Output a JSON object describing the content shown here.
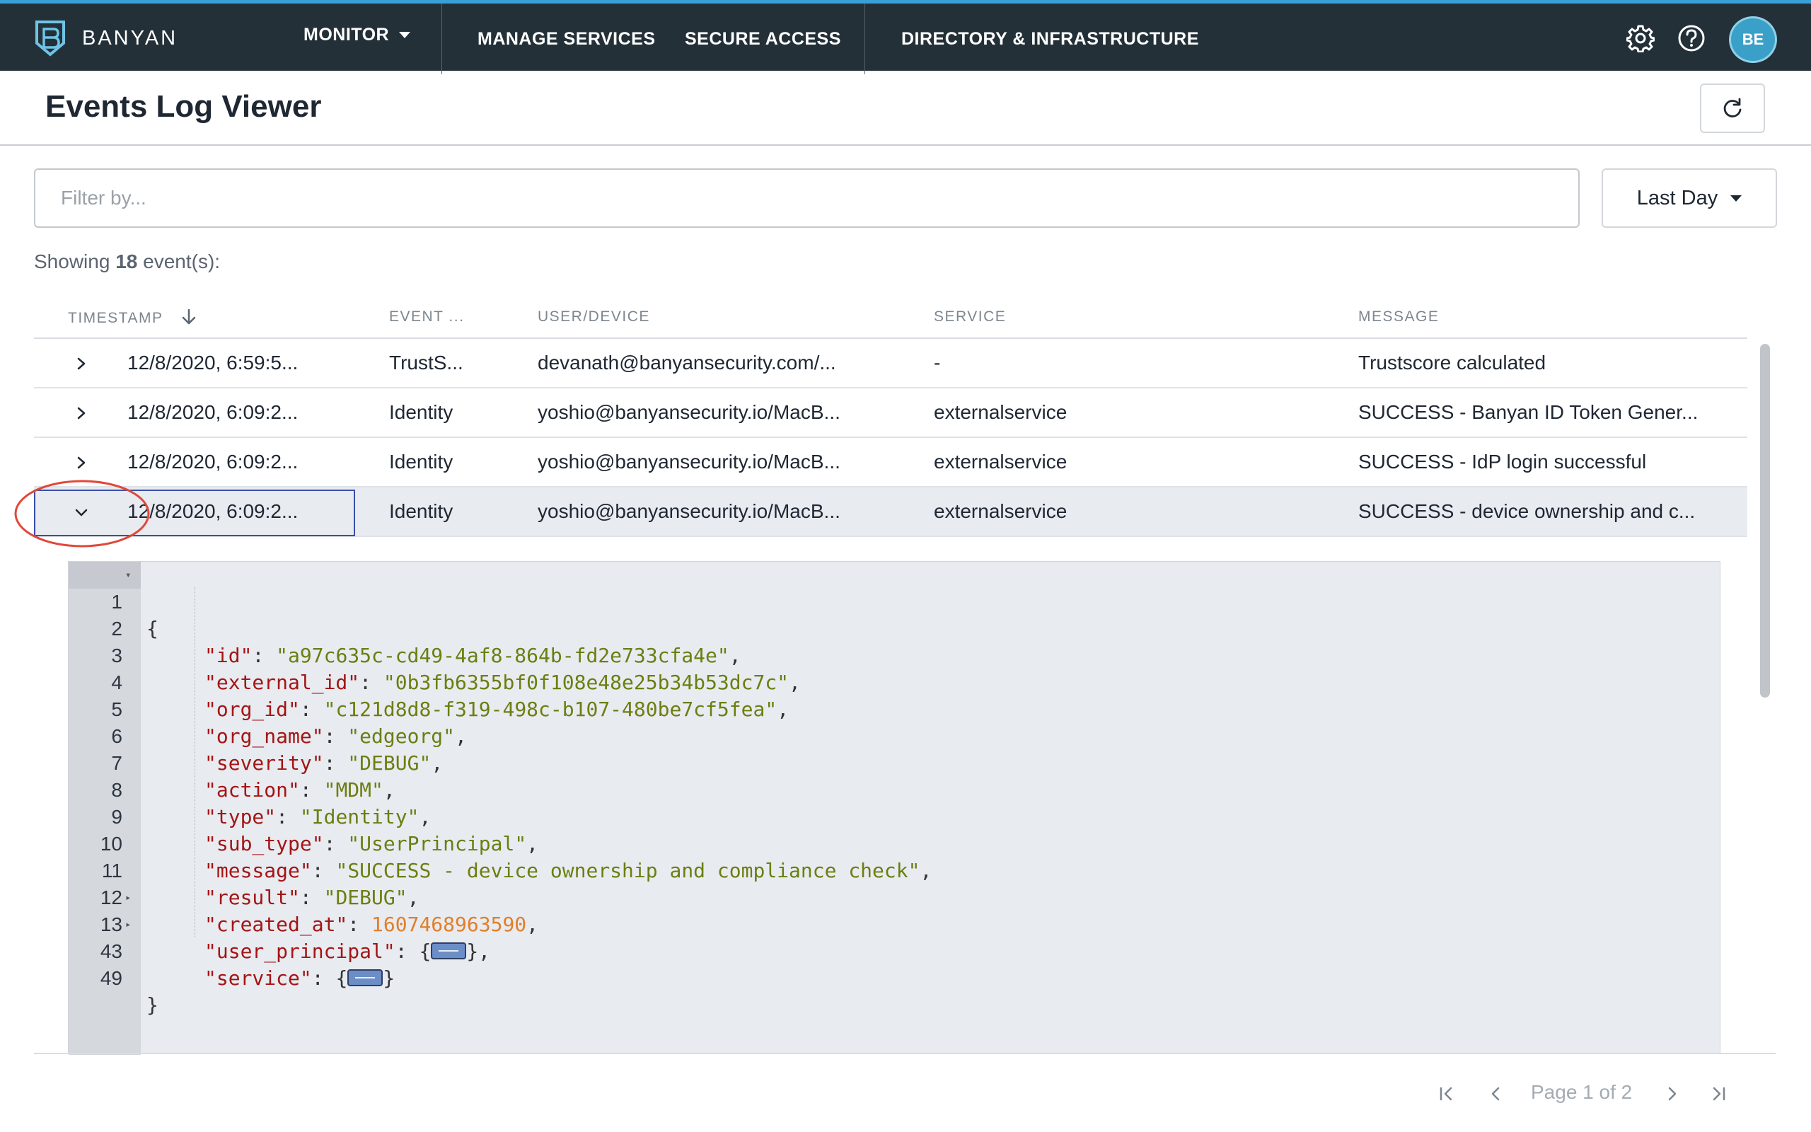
{
  "nav": {
    "brand": "BANYAN",
    "items": [
      {
        "label": "MONITOR"
      },
      {
        "label": "MANAGE SERVICES"
      },
      {
        "label": "SECURE ACCESS"
      },
      {
        "label": "DIRECTORY & INFRASTRUCTURE"
      }
    ],
    "avatar_initials": "BE",
    "icons": [
      "settings-icon",
      "help-icon"
    ]
  },
  "header": {
    "title": "Events Log Viewer",
    "refresh_icon": "refresh-icon"
  },
  "filter": {
    "placeholder": "Filter by...",
    "value": "",
    "range_label": "Last Day"
  },
  "summary": {
    "prefix": "Showing ",
    "count": "18",
    "suffix": " event(s):"
  },
  "table": {
    "columns": [
      "TIMESTAMP",
      "EVENT ...",
      "USER/DEVICE",
      "SERVICE",
      "MESSAGE"
    ],
    "sort_icon": "arrow-down-icon",
    "rows": [
      {
        "timestamp": "12/8/2020, 6:59:5...",
        "event": "TrustS...",
        "user": "devanath@banyansecurity.com/...",
        "service": "-",
        "message": "Trustscore calculated",
        "expanded": false
      },
      {
        "timestamp": "12/8/2020, 6:09:2...",
        "event": "Identity",
        "user": "yoshio@banyansecurity.io/MacB...",
        "service": "externalservice",
        "message": "SUCCESS - Banyan ID Token Gener...",
        "expanded": false
      },
      {
        "timestamp": "12/8/2020, 6:09:2...",
        "event": "Identity",
        "user": "yoshio@banyansecurity.io/MacB...",
        "service": "externalservice",
        "message": "SUCCESS - IdP login successful",
        "expanded": false
      },
      {
        "timestamp": "12/8/2020, 6:09:2...",
        "event": "Identity",
        "user": "yoshio@banyansecurity.io/MacB...",
        "service": "externalservice",
        "message": "SUCCESS - device ownership and c...",
        "expanded": true
      }
    ]
  },
  "json_view": {
    "lines": [
      {
        "num": "1",
        "fold": "open",
        "text": "{"
      },
      {
        "num": "2",
        "key": "id",
        "value": "a97c635c-cd49-4af8-864b-fd2e733cfa4e",
        "type": "string"
      },
      {
        "num": "3",
        "key": "external_id",
        "value": "0b3fb6355bf0f108e48e25b34b53dc7c",
        "type": "string"
      },
      {
        "num": "4",
        "key": "org_id",
        "value": "c121d8d8-f319-498c-b107-480be7cf5fea",
        "type": "string"
      },
      {
        "num": "5",
        "key": "org_name",
        "value": "edgeorg",
        "type": "string"
      },
      {
        "num": "6",
        "key": "severity",
        "value": "DEBUG",
        "type": "string"
      },
      {
        "num": "7",
        "key": "action",
        "value": "MDM",
        "type": "string"
      },
      {
        "num": "8",
        "key": "type",
        "value": "Identity",
        "type": "string"
      },
      {
        "num": "9",
        "key": "sub_type",
        "value": "UserPrincipal",
        "type": "string"
      },
      {
        "num": "10",
        "key": "message",
        "value": "SUCCESS - device ownership and compliance check",
        "type": "string"
      },
      {
        "num": "11",
        "key": "result",
        "value": "DEBUG",
        "type": "string"
      },
      {
        "num": "12",
        "key": "created_at",
        "value": "1607468963590",
        "type": "number"
      },
      {
        "num": "13",
        "fold": "closed",
        "key": "user_principal",
        "type": "object"
      },
      {
        "num": "43",
        "fold": "closed",
        "key": "service",
        "type": "object"
      },
      {
        "num": "49",
        "text": "}"
      }
    ]
  },
  "pagination": {
    "label": "Page 1 of 2"
  },
  "colors": {
    "nav_bg": "#243038",
    "accent": "#3aa0d8",
    "json_key": "#a31515",
    "json_string": "#6a7f10",
    "json_number": "#e07f2a",
    "annotation": "#e0483a"
  }
}
